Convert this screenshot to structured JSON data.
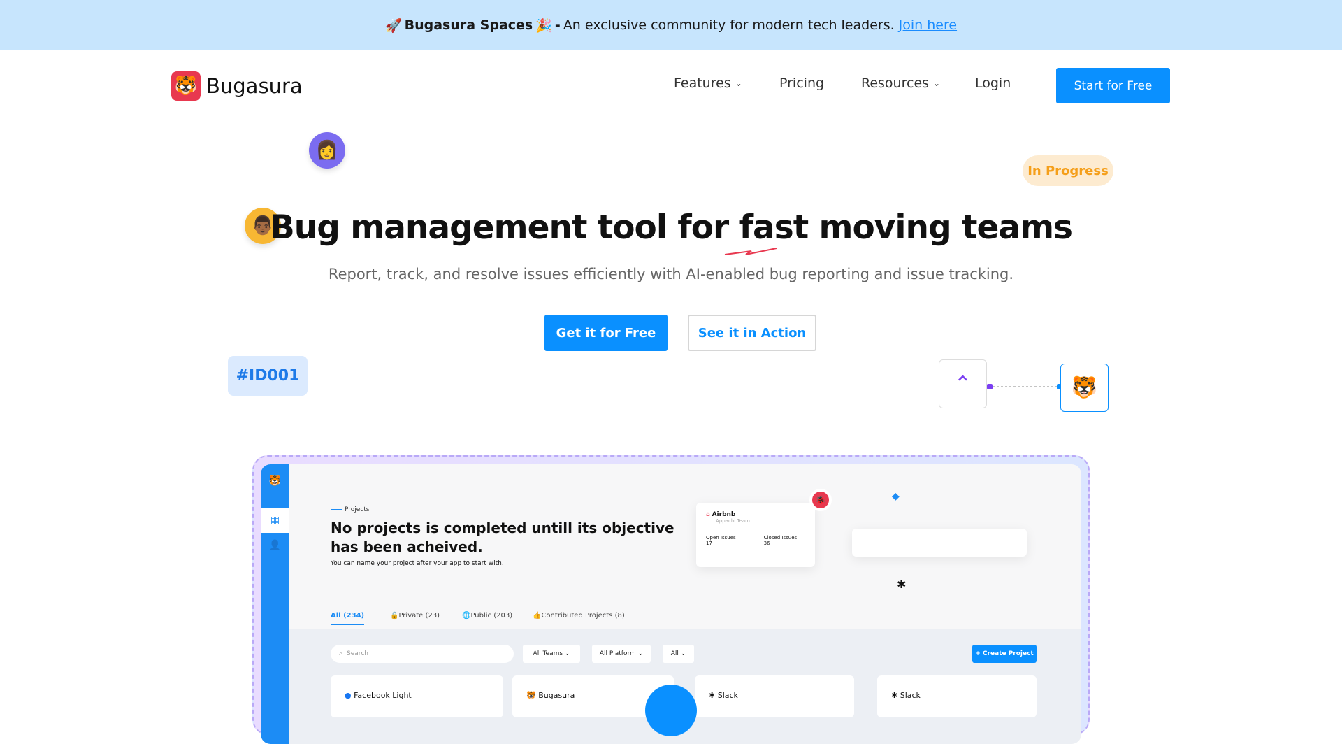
{
  "banner": {
    "rocket": "🚀",
    "brand": "Bugasura Spaces",
    "party": "🎉",
    "dash": "-",
    "text": "An exclusive community for modern tech leaders.",
    "link": "Join here"
  },
  "header": {
    "logo": "Bugasura",
    "nav": [
      {
        "label": "Features",
        "dropdown": true
      },
      {
        "label": "Pricing"
      },
      {
        "label": "Resources",
        "dropdown": true
      },
      {
        "label": "Login"
      }
    ],
    "cta": "Start for Free"
  },
  "hero": {
    "badge": "In Progress",
    "title": "Bug management tool for fast moving teams",
    "subtitle": "Report, track, and resolve issues efficiently with AI-enabled bug reporting and issue tracking.",
    "primary": "Get it for Free",
    "secondary": "See it in Action",
    "tag": "#ID001"
  },
  "colors": {
    "accent": "#0a90ff",
    "brand": "#e8384f",
    "banner": "#c7e5fd",
    "badge": "#f59f1a"
  },
  "mockup": {
    "section": "Projects",
    "headline1": "No projects is completed untill its objective",
    "headline2": "has been acheived.",
    "hint": "You can name your project after your app to start with.",
    "tabs": [
      "All (234)",
      "Private (23)",
      "Public (203)",
      "Contributed Projects (8)"
    ],
    "search": "Search",
    "filters": [
      "All Teams",
      "All Platform",
      "All"
    ],
    "create": "+ Create Project",
    "cards": [
      "Facebook Light",
      "Bugasura",
      "Slack",
      "Slack"
    ],
    "widget": {
      "name": "Airbnb",
      "team": "Appachi Team",
      "open_label": "Open Issues",
      "open": "17",
      "closed_label": "Closed Issues",
      "closed": "36"
    }
  }
}
